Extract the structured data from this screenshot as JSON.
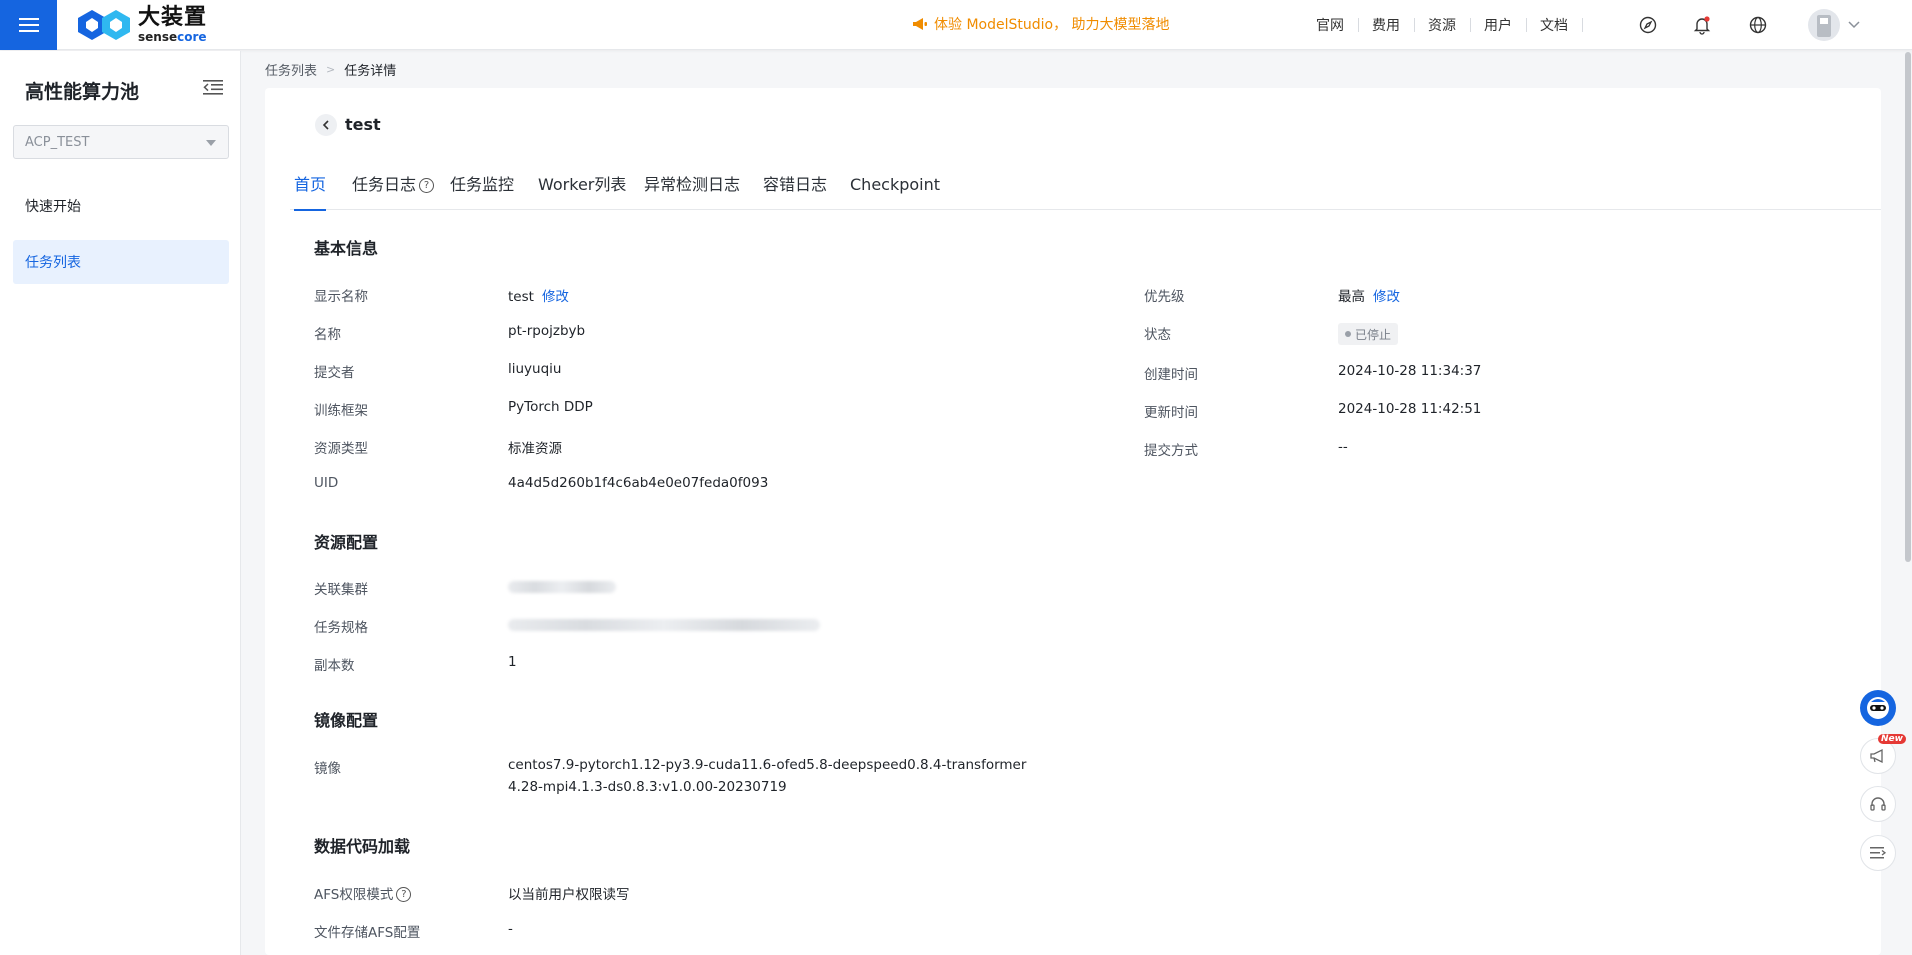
{
  "topbar": {
    "logo_cn": "大装置",
    "logo_en_a": "sense",
    "logo_en_b": "core",
    "promo": "体验 ModelStudio， 助力大模型落地",
    "nav": [
      "官网",
      "费用",
      "资源",
      "用户",
      "文档"
    ],
    "accent": "#1565e0",
    "promo_color": "#f08c00"
  },
  "sidebar": {
    "title": "高性能算力池",
    "workspace": "ACP_TEST",
    "items": [
      {
        "label": "快速开始",
        "active": false
      },
      {
        "label": "任务列表",
        "active": true
      }
    ]
  },
  "breadcrumb": [
    "任务列表",
    "任务详情"
  ],
  "job": {
    "title": "test",
    "tabs": [
      "首页",
      "任务日志",
      "任务监控",
      "Worker列表",
      "异常检测日志",
      "容错日志",
      "Checkpoint"
    ],
    "basic": {
      "heading": "基本信息",
      "display_name_label": "显示名称",
      "display_name": "test",
      "edit": "修改",
      "name_label": "名称",
      "name": "pt-rpojzbyb",
      "submitter_label": "提交者",
      "submitter": "liuyuqiu",
      "framework_label": "训练框架",
      "framework": "PyTorch DDP",
      "resource_type_label": "资源类型",
      "resource_type": "标准资源",
      "uid_label": "UID",
      "uid": "4a4d5d260b1f4c6ab4e0e07feda0f093",
      "priority_label": "优先级",
      "priority": "最高",
      "status_label": "状态",
      "status": "已停止",
      "created_label": "创建时间",
      "created": "2024-10-28 11:34:37",
      "updated_label": "更新时间",
      "updated": "2024-10-28 11:42:51",
      "submit_mode_label": "提交方式",
      "submit_mode": "--"
    },
    "resource": {
      "heading": "资源配置",
      "cluster_label": "关联集群",
      "spec_label": "任务规格",
      "replicas_label": "副本数",
      "replicas": "1"
    },
    "image": {
      "heading": "镜像配置",
      "label": "镜像",
      "value": "centos7.9-pytorch1.12-py3.9-cuda11.6-ofed5.8-deepspeed0.8.4-transformer4.28-mpi4.1.3-ds0.8.3:v1.0.00-20230719"
    },
    "data": {
      "heading": "数据代码加载",
      "afs_label": "AFS权限模式",
      "afs": "以当前用户权限读写",
      "storage_label": "文件存储AFS配置",
      "storage": "-"
    }
  },
  "float": {
    "new_badge": "New"
  }
}
